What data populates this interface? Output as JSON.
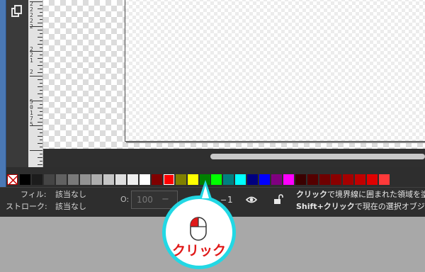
{
  "ruler": {
    "labels": [
      {
        "text": "2"
      },
      {
        "text": "2"
      },
      {
        "text": "2"
      },
      {
        "text": "2"
      },
      {
        "text": "2"
      },
      {
        "text": "2"
      },
      {
        "text": "2"
      },
      {
        "text": "1"
      },
      {
        "text": "2"
      },
      {
        "text": "5"
      },
      {
        "text": "0"
      },
      {
        "text": "1"
      },
      {
        "text": "7"
      },
      {
        "text": "5"
      }
    ]
  },
  "palette": {
    "swatches": [
      "#000000",
      "#1c1c1c",
      "#454545",
      "#616161",
      "#7a7a7a",
      "#939393",
      "#aeaeae",
      "#c6c6c6",
      "#dfdfdf",
      "#efefef",
      "#ffffff",
      "#800000",
      "#ff0000",
      "#808000",
      "#ffff00",
      "#008000",
      "#00ff00",
      "#008080",
      "#00ffff",
      "#000080",
      "#0000ff",
      "#800080",
      "#ff00ff",
      "#3a0000",
      "#550000",
      "#6f0000",
      "#8a0000",
      "#a50000",
      "#c00000",
      "#e00000",
      "#ff3a3a"
    ],
    "highlighted_color": "#ff0000"
  },
  "status": {
    "fill_label": "フィル:",
    "fill_value": "該当なし",
    "stroke_label": "ストローク:",
    "stroke_value": "該当なし",
    "opacity_label": "O:",
    "opacity_value": "100",
    "opacity_minus": "−",
    "layer_prefix": "−",
    "layer_value": "1",
    "hint_line1_bold": "クリック",
    "hint_line1_rest": "で境界線に囲まれた領域を塗り",
    "hint_line2_bold": "Shift+クリック",
    "hint_line2_rest": "で現在の選択オブジェク"
  },
  "callout": {
    "text": "クリック",
    "color": "#22d8e4",
    "text_color": "#e01818"
  }
}
